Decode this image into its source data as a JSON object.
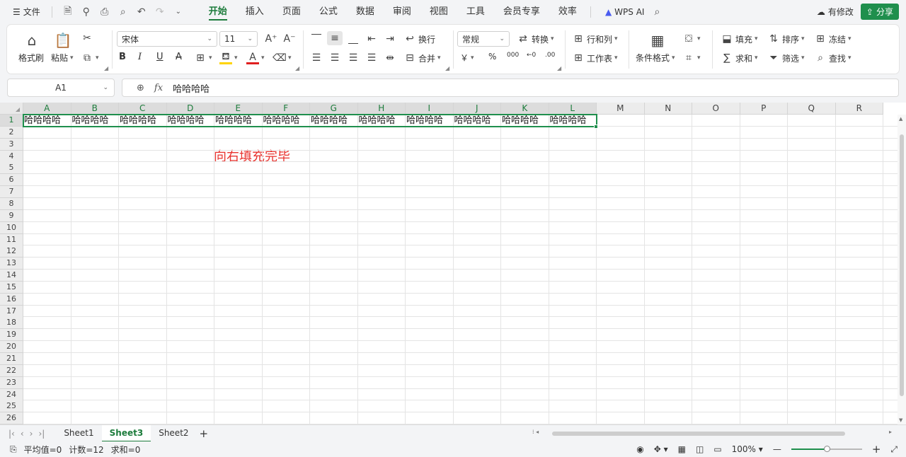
{
  "menubar": {
    "file_label": "文件",
    "tabs": [
      "开始",
      "插入",
      "页面",
      "公式",
      "数据",
      "审阅",
      "视图",
      "工具",
      "会员专享",
      "效率"
    ],
    "active_tab": "开始",
    "wps_ai_label": "WPS AI",
    "modify_label": "有修改",
    "share_label": "分享"
  },
  "ribbon": {
    "format_painter": "格式刷",
    "paste": "粘贴",
    "font_name": "宋体",
    "font_size": "11",
    "wrap_text": "换行",
    "merge": "合并",
    "number_format": "常规",
    "convert": "转换",
    "row_col": "行和列",
    "worksheet": "工作表",
    "cond_format": "条件格式",
    "fill": "填充",
    "sort": "排序",
    "freeze": "冻结",
    "sum": "求和",
    "filter": "筛选",
    "find": "查找",
    "bold": "B",
    "italic": "I",
    "underline": "U",
    "strike": "A",
    "percent": "%",
    "thousands": "000",
    "dec_inc": "←0",
    "dec_dec": ".00",
    "currency": "￥"
  },
  "formula_bar": {
    "name_box": "A1",
    "fx_label": "fx",
    "value": "哈哈哈哈"
  },
  "grid": {
    "columns": [
      "A",
      "B",
      "C",
      "D",
      "E",
      "F",
      "G",
      "H",
      "I",
      "J",
      "K",
      "L",
      "M",
      "N",
      "O",
      "P",
      "Q",
      "R"
    ],
    "rows": [
      "1",
      "2",
      "3",
      "4",
      "5",
      "6",
      "7",
      "8",
      "9",
      "10",
      "11",
      "12",
      "13",
      "14",
      "15",
      "16",
      "17",
      "18",
      "19",
      "20",
      "21",
      "22",
      "23",
      "24",
      "25",
      "26"
    ],
    "row1_values": [
      "哈哈哈哈",
      "哈哈哈哈",
      "哈哈哈哈",
      "哈哈哈哈",
      "哈哈哈哈",
      "哈哈哈哈",
      "哈哈哈哈",
      "哈哈哈哈",
      "哈哈哈哈",
      "哈哈哈哈",
      "哈哈哈哈",
      "哈哈哈哈"
    ],
    "annotation": "向右填充完毕"
  },
  "sheets": {
    "tabs": [
      "Sheet1",
      "Sheet3",
      "Sheet2"
    ],
    "active": "Sheet3"
  },
  "statusbar": {
    "average": "平均值=0",
    "count": "计数=12",
    "sum": "求和=0",
    "zoom": "100%",
    "zoom_fraction": 0.5
  },
  "colors": {
    "accent": "#1f8f4d",
    "annotation": "#e8332e"
  }
}
